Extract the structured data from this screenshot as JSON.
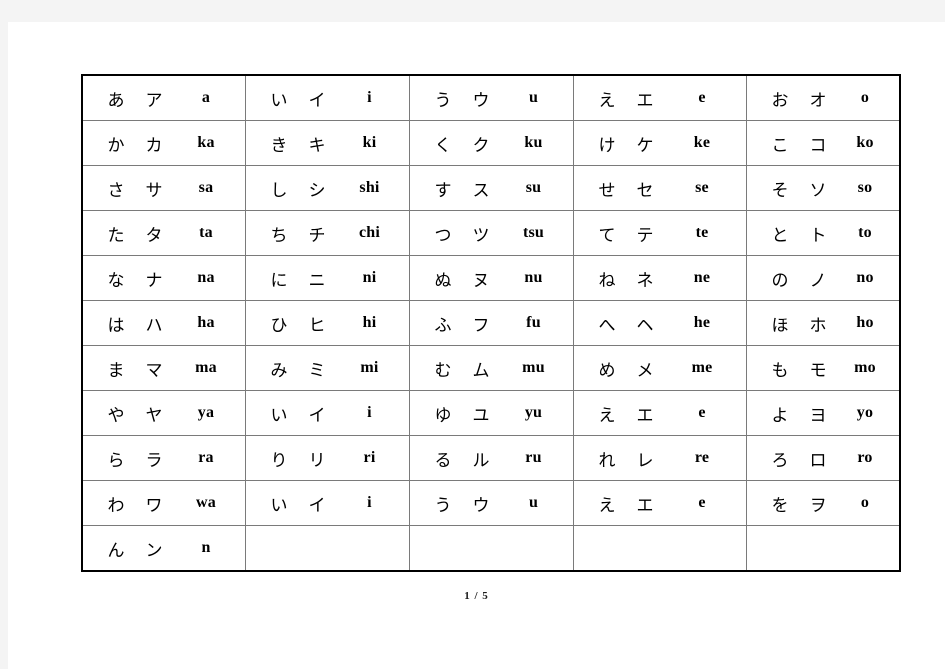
{
  "document": {
    "footer": "1 / 5"
  },
  "table": {
    "rows": [
      [
        {
          "hiragana": "あ",
          "katakana": "ア",
          "romaji": "a"
        },
        {
          "hiragana": "い",
          "katakana": "イ",
          "romaji": "i"
        },
        {
          "hiragana": "う",
          "katakana": "ウ",
          "romaji": "u"
        },
        {
          "hiragana": "え",
          "katakana": "エ",
          "romaji": "e"
        },
        {
          "hiragana": "お",
          "katakana": "オ",
          "romaji": "o"
        }
      ],
      [
        {
          "hiragana": "か",
          "katakana": "カ",
          "romaji": "ka"
        },
        {
          "hiragana": "き",
          "katakana": "キ",
          "romaji": "ki"
        },
        {
          "hiragana": "く",
          "katakana": "ク",
          "romaji": "ku"
        },
        {
          "hiragana": "け",
          "katakana": "ケ",
          "romaji": "ke"
        },
        {
          "hiragana": "こ",
          "katakana": "コ",
          "romaji": "ko"
        }
      ],
      [
        {
          "hiragana": "さ",
          "katakana": "サ",
          "romaji": "sa"
        },
        {
          "hiragana": "し",
          "katakana": "シ",
          "romaji": "shi"
        },
        {
          "hiragana": "す",
          "katakana": "ス",
          "romaji": "su"
        },
        {
          "hiragana": "せ",
          "katakana": "セ",
          "romaji": "se"
        },
        {
          "hiragana": "そ",
          "katakana": "ソ",
          "romaji": "so"
        }
      ],
      [
        {
          "hiragana": "た",
          "katakana": "タ",
          "romaji": "ta"
        },
        {
          "hiragana": "ち",
          "katakana": "チ",
          "romaji": "chi"
        },
        {
          "hiragana": "つ",
          "katakana": "ツ",
          "romaji": "tsu"
        },
        {
          "hiragana": "て",
          "katakana": "テ",
          "romaji": "te"
        },
        {
          "hiragana": "と",
          "katakana": "ト",
          "romaji": "to"
        }
      ],
      [
        {
          "hiragana": "な",
          "katakana": "ナ",
          "romaji": "na"
        },
        {
          "hiragana": "に",
          "katakana": "ニ",
          "romaji": "ni"
        },
        {
          "hiragana": "ぬ",
          "katakana": "ヌ",
          "romaji": "nu"
        },
        {
          "hiragana": "ね",
          "katakana": "ネ",
          "romaji": "ne"
        },
        {
          "hiragana": "の",
          "katakana": "ノ",
          "romaji": "no"
        }
      ],
      [
        {
          "hiragana": "は",
          "katakana": "ハ",
          "romaji": "ha"
        },
        {
          "hiragana": "ひ",
          "katakana": "ヒ",
          "romaji": "hi"
        },
        {
          "hiragana": "ふ",
          "katakana": "フ",
          "romaji": "fu"
        },
        {
          "hiragana": "へ",
          "katakana": "ヘ",
          "romaji": "he"
        },
        {
          "hiragana": "ほ",
          "katakana": "ホ",
          "romaji": "ho"
        }
      ],
      [
        {
          "hiragana": "ま",
          "katakana": "マ",
          "romaji": "ma"
        },
        {
          "hiragana": "み",
          "katakana": "ミ",
          "romaji": "mi"
        },
        {
          "hiragana": "む",
          "katakana": "ム",
          "romaji": "mu"
        },
        {
          "hiragana": "め",
          "katakana": "メ",
          "romaji": "me"
        },
        {
          "hiragana": "も",
          "katakana": "モ",
          "romaji": "mo"
        }
      ],
      [
        {
          "hiragana": "や",
          "katakana": "ヤ",
          "romaji": "ya"
        },
        {
          "hiragana": "い",
          "katakana": "イ",
          "romaji": "i"
        },
        {
          "hiragana": "ゆ",
          "katakana": "ユ",
          "romaji": "yu"
        },
        {
          "hiragana": "え",
          "katakana": "エ",
          "romaji": "e"
        },
        {
          "hiragana": "よ",
          "katakana": "ヨ",
          "romaji": "yo"
        }
      ],
      [
        {
          "hiragana": "ら",
          "katakana": "ラ",
          "romaji": "ra"
        },
        {
          "hiragana": "り",
          "katakana": "リ",
          "romaji": "ri"
        },
        {
          "hiragana": "る",
          "katakana": "ル",
          "romaji": "ru"
        },
        {
          "hiragana": "れ",
          "katakana": "レ",
          "romaji": "re"
        },
        {
          "hiragana": "ろ",
          "katakana": "ロ",
          "romaji": "ro"
        }
      ],
      [
        {
          "hiragana": "わ",
          "katakana": "ワ",
          "romaji": "wa"
        },
        {
          "hiragana": "い",
          "katakana": "イ",
          "romaji": "i"
        },
        {
          "hiragana": "う",
          "katakana": "ウ",
          "romaji": "u"
        },
        {
          "hiragana": "え",
          "katakana": "エ",
          "romaji": "e"
        },
        {
          "hiragana": "を",
          "katakana": "ヲ",
          "romaji": "o"
        }
      ],
      [
        {
          "hiragana": "ん",
          "katakana": "ン",
          "romaji": "n"
        },
        {
          "hiragana": "",
          "katakana": "",
          "romaji": ""
        },
        {
          "hiragana": "",
          "katakana": "",
          "romaji": ""
        },
        {
          "hiragana": "",
          "katakana": "",
          "romaji": ""
        },
        {
          "hiragana": "",
          "katakana": "",
          "romaji": ""
        }
      ]
    ]
  }
}
